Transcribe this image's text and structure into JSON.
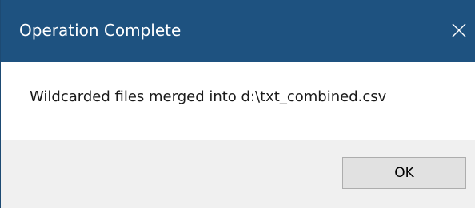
{
  "window": {
    "title": "Operation Complete",
    "close_icon": "close-icon",
    "titlebar_color": "#1e5280"
  },
  "message": {
    "text": "Wildcarded files merged into d:\\txt_combined.csv"
  },
  "buttons": {
    "ok_label": "OK"
  }
}
